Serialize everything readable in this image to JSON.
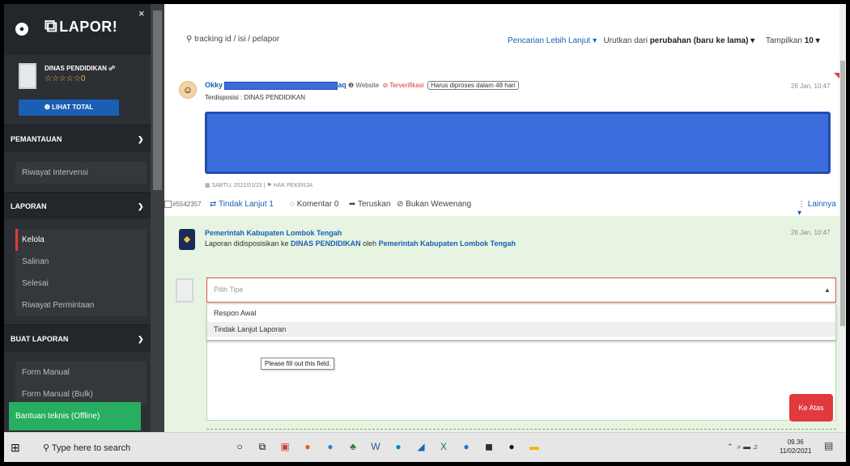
{
  "sidebar": {
    "logo_text": "LAPOR!",
    "close_label": "×",
    "profile_name": "DINAS PENDIDIKAN ☍",
    "profile_rating": "☆☆☆☆☆0",
    "lihat_total": "❶ LIHAT TOTAL",
    "sections": {
      "pemantauan": {
        "title": "PEMANTAUAN",
        "items": [
          "Riwayat Intervensi"
        ]
      },
      "laporan": {
        "title": "LAPORAN",
        "items": [
          "Kelola",
          "Salinan",
          "Selesai",
          "Riwayat Permintaan"
        ]
      },
      "buat_laporan": {
        "title": "BUAT LAPORAN",
        "items": [
          "Form Manual",
          "Form Manual (Bulk)"
        ]
      }
    },
    "help_button": "Bantuan teknis (Offline)"
  },
  "search": {
    "placeholder": "tracking id / isi / pelapor",
    "advanced": "Pencarian Lebih Lanjut ▾",
    "sort_prefix": "Urutkan dari",
    "sort_value": "perubahan (baru ke lama) ▾",
    "show_prefix": "Tampilkan",
    "show_value": "10 ▾"
  },
  "report": {
    "name_prefix": "Okky",
    "name_suffix": "aq",
    "source": "❷ Website",
    "verified": "⊘ Terverifikasi",
    "deadline": "Harus diproses dalam 48 hari",
    "disposition": "Terdisposisi : DINAS PENDIDIKAN",
    "date": "26 Jan, 10:47",
    "meta": "▦ SABTU, 2021/01/23 | ⚑ HAK PEKERJA"
  },
  "tabs": {
    "tracking_id": "#5542357",
    "tindak_lanjut": "⇄ Tindak Lanjut 1",
    "komentar": "◌ Komentar 0",
    "teruskan": "➦ Teruskan",
    "bukan_wewenang": "⊘ Bukan Wewenang",
    "lainnya": "⋮ Lainnya ▾"
  },
  "disposition_entry": {
    "title": "Pemerintah Kabupaten Lombok Tengah",
    "text_prefix": "Laporan didisposisikan ke",
    "target": "DINAS PENDIDIKAN",
    "text_mid": "oleh",
    "by": "Pemerintah Kabupaten Lombok Tengah",
    "date": "26 Jan, 10:47"
  },
  "form": {
    "select_placeholder": "Pilih Tipe",
    "options": [
      "Respon Awal",
      "Tindak Lanjut Laporan"
    ],
    "tooltip": "Please fill out this field.",
    "scroll_top": "Ke Atas"
  },
  "taskbar": {
    "search_placeholder": "Type here to search",
    "time": "09.36",
    "date": "11/02/2021"
  }
}
